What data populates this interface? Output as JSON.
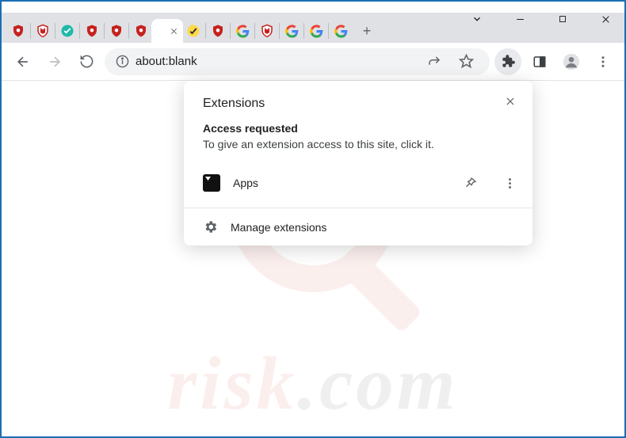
{
  "window_controls": {
    "dropdown": "chevron-down",
    "minimize": "—",
    "maximize": "▢",
    "close": "✕"
  },
  "tabs": {
    "icons": [
      "shield-red",
      "mcafee",
      "teal-check",
      "shield-red",
      "shield-red",
      "shield-red",
      "active-close",
      "norton",
      "shield-red",
      "google",
      "mcafee",
      "google",
      "google",
      "google"
    ],
    "newtab_label": "+"
  },
  "addr": {
    "back": "←",
    "forward": "→",
    "reload": "⟳",
    "info_icon": "info",
    "url": "about:blank",
    "share": "share",
    "star": "star",
    "extensions": "puzzle",
    "sidepanel": "sidepanel",
    "profile": "profile",
    "menu": "⋮"
  },
  "popup": {
    "title": "Extensions",
    "close": "✕",
    "access_heading": "Access requested",
    "access_desc": "To give an extension access to this site, click it.",
    "item_label": "Apps",
    "pin_icon": "pin",
    "more_icon": "⋮",
    "manage_icon": "gear",
    "manage_label": "Manage extensions"
  },
  "watermark": {
    "part1": "risk",
    "part2": ".com"
  }
}
